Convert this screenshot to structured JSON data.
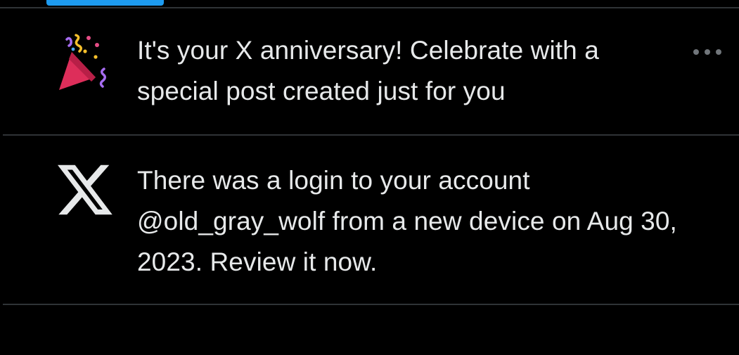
{
  "colors": {
    "background": "#000000",
    "text": "#e7e9ea",
    "divider": "#2f3336",
    "accent": "#1d9bf0",
    "muted": "#71767b"
  },
  "notifications": [
    {
      "icon": "party-popper-icon",
      "text": "It's your X anniversary! Celebrate with a special post created just for you",
      "has_more_menu": true
    },
    {
      "icon": "x-logo-icon",
      "text": "There was a login to your account @old_gray_wolf from a new device on Aug 30, 2023. Review it now.",
      "has_more_menu": false
    }
  ]
}
